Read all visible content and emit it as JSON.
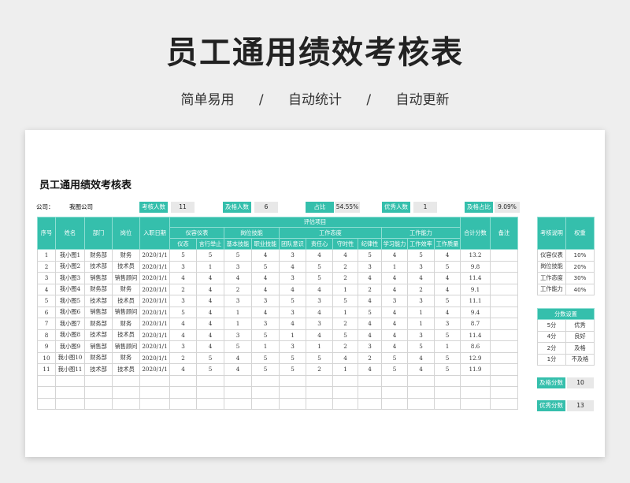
{
  "header": {
    "title": "员工通用绩效考核表",
    "subtitle": [
      "简单易用",
      "/",
      "自动统计",
      "/",
      "自动更新"
    ]
  },
  "sheet": {
    "title": "员工通用绩效考核表",
    "company_label": "公司：",
    "company_value": "我图公司",
    "stats": [
      {
        "label": "考核人数",
        "value": "11"
      },
      {
        "label": "及格人数",
        "value": "6"
      },
      {
        "label": "占比",
        "value": "54.55%"
      },
      {
        "label": "优秀人数",
        "value": "1"
      },
      {
        "label": "及格占比",
        "value": "9.09%"
      }
    ],
    "headers": {
      "no": "序号",
      "name": "姓名",
      "dept": "部门",
      "post": "岗位",
      "date": "入职日期",
      "eval": "评估项目",
      "total": "合计分数",
      "note": "备注",
      "groups": [
        "仪容仪表",
        "岗位技能",
        "工作态度",
        "工作能力"
      ],
      "subs": [
        "仪态",
        "言行举止",
        "基本技能",
        "职业技能",
        "团队意识",
        "责任心",
        "守时性",
        "纪律性",
        "学习能力",
        "工作效率",
        "工作质量"
      ]
    },
    "rows": [
      [
        "1",
        "我小图1",
        "财务部",
        "财务",
        "2020/1/1",
        "5",
        "5",
        "5",
        "4",
        "3",
        "4",
        "4",
        "5",
        "4",
        "5",
        "4",
        "13.2",
        ""
      ],
      [
        "2",
        "我小图2",
        "技术部",
        "技术员",
        "2020/1/1",
        "3",
        "1",
        "3",
        "5",
        "4",
        "5",
        "2",
        "3",
        "1",
        "3",
        "5",
        "9.8",
        ""
      ],
      [
        "3",
        "我小图3",
        "销售部",
        "销售顾问",
        "2020/1/1",
        "4",
        "4",
        "4",
        "4",
        "3",
        "5",
        "2",
        "4",
        "4",
        "4",
        "4",
        "11.4",
        ""
      ],
      [
        "4",
        "我小图4",
        "财务部",
        "财务",
        "2020/1/1",
        "2",
        "4",
        "2",
        "4",
        "4",
        "4",
        "1",
        "2",
        "4",
        "2",
        "4",
        "9.1",
        ""
      ],
      [
        "5",
        "我小图5",
        "技术部",
        "技术员",
        "2020/1/1",
        "3",
        "4",
        "3",
        "3",
        "5",
        "3",
        "5",
        "4",
        "3",
        "3",
        "5",
        "11.1",
        ""
      ],
      [
        "6",
        "我小图6",
        "销售部",
        "销售顾问",
        "2020/1/1",
        "5",
        "4",
        "1",
        "4",
        "3",
        "4",
        "1",
        "5",
        "4",
        "1",
        "4",
        "9.4",
        ""
      ],
      [
        "7",
        "我小图7",
        "财务部",
        "财务",
        "2020/1/1",
        "4",
        "4",
        "1",
        "3",
        "4",
        "3",
        "2",
        "4",
        "4",
        "1",
        "3",
        "8.7",
        ""
      ],
      [
        "8",
        "我小图8",
        "技术部",
        "技术员",
        "2020/1/1",
        "4",
        "4",
        "3",
        "5",
        "1",
        "4",
        "5",
        "4",
        "4",
        "3",
        "5",
        "11.4",
        ""
      ],
      [
        "9",
        "我小图9",
        "销售部",
        "销售顾问",
        "2020/1/1",
        "3",
        "4",
        "5",
        "1",
        "3",
        "1",
        "2",
        "3",
        "4",
        "5",
        "1",
        "8.6",
        ""
      ],
      [
        "10",
        "我小图10",
        "财务部",
        "财务",
        "2020/1/1",
        "2",
        "5",
        "4",
        "5",
        "5",
        "5",
        "4",
        "2",
        "5",
        "4",
        "5",
        "12.9",
        ""
      ],
      [
        "11",
        "我小图11",
        "技术部",
        "技术员",
        "2020/1/1",
        "4",
        "5",
        "4",
        "5",
        "5",
        "2",
        "1",
        "4",
        "5",
        "4",
        "5",
        "11.9",
        ""
      ]
    ],
    "blank_rows": 3,
    "weights": {
      "headers": [
        "考核说明",
        "权重"
      ],
      "rows": [
        [
          "仪容仪表",
          "10%"
        ],
        [
          "岗位技能",
          "20%"
        ],
        [
          "工作态度",
          "30%"
        ],
        [
          "工作能力",
          "40%"
        ]
      ]
    },
    "grading": {
      "title": "分数设置",
      "rows": [
        [
          "5分",
          "优秀"
        ],
        [
          "4分",
          "良好"
        ],
        [
          "2分",
          "及格"
        ],
        [
          "1分",
          "不及格"
        ]
      ]
    },
    "pass_score": {
      "label": "及格分数",
      "value": "10"
    },
    "excellent_score": {
      "label": "优秀分数",
      "value": "13"
    }
  }
}
